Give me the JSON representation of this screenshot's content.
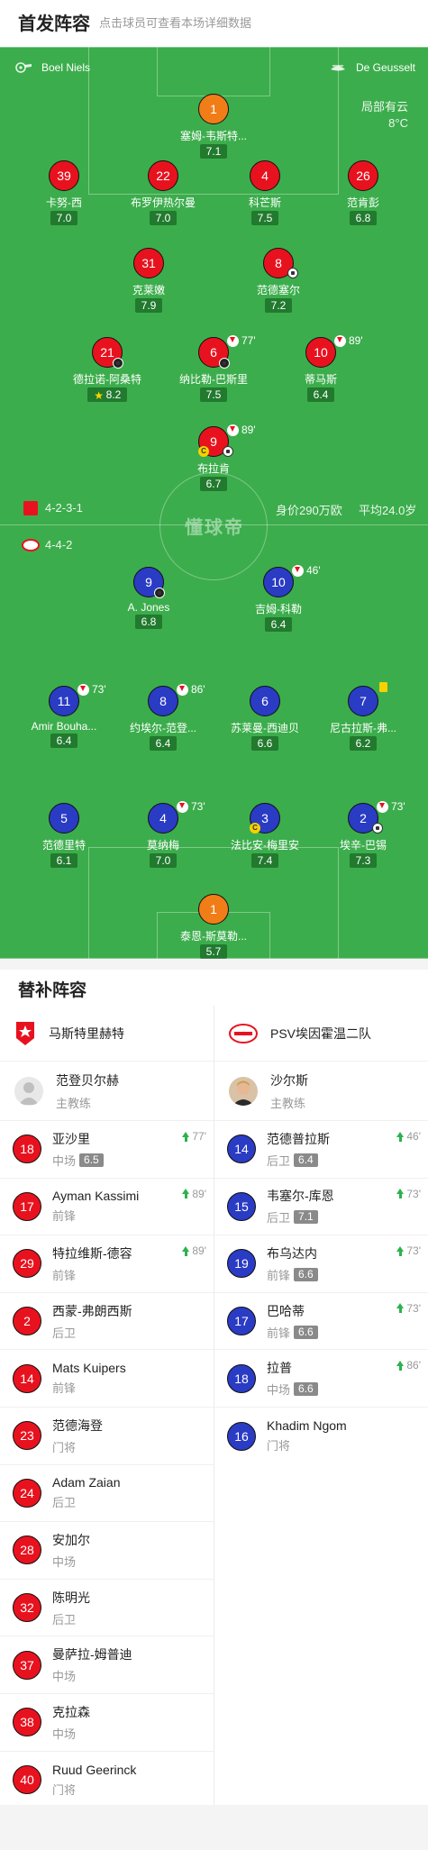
{
  "header": {
    "title": "首发阵容",
    "hint": "点击球员可查看本场详细数据"
  },
  "pitch": {
    "home_referee": "Boel Niels",
    "away_referee": "De Geusselt",
    "weather": {
      "condition": "局部有云",
      "temp": "8°C"
    },
    "home_formation": "4-2-3-1",
    "away_formation": "4-4-2",
    "market_value": "身价290万欧",
    "avg_age": "平均24.0岁",
    "watermark": "懂球帝",
    "home_players": [
      {
        "num": "1",
        "name": "塞姆-韦斯特...",
        "rating": "7.1"
      },
      {
        "num": "39",
        "name": "卡努-西",
        "rating": "7.0"
      },
      {
        "num": "22",
        "name": "布罗伊热尔曼",
        "rating": "7.0"
      },
      {
        "num": "4",
        "name": "科芒斯",
        "rating": "7.5"
      },
      {
        "num": "26",
        "name": "范肯彭",
        "rating": "6.8"
      },
      {
        "num": "31",
        "name": "克莱嫩",
        "rating": "7.9"
      },
      {
        "num": "8",
        "name": "范德塞尔",
        "rating": "7.2"
      },
      {
        "num": "21",
        "name": "德拉诺-阿桑特",
        "rating": "8.2"
      },
      {
        "num": "6",
        "name": "纳比勒-巴斯里",
        "rating": "7.5",
        "sub": "77'"
      },
      {
        "num": "10",
        "name": "蒂马斯",
        "rating": "6.4",
        "sub": "89'"
      },
      {
        "num": "9",
        "name": "布拉肯",
        "rating": "6.7",
        "sub": "89'"
      }
    ],
    "away_players": [
      {
        "num": "9",
        "name": "A. Jones",
        "rating": "6.8"
      },
      {
        "num": "10",
        "name": "吉姆-科勒",
        "rating": "6.4",
        "sub": "46'"
      },
      {
        "num": "11",
        "name": "Amir Bouha...",
        "rating": "6.4",
        "sub": "73'"
      },
      {
        "num": "8",
        "name": "约埃尔-范登...",
        "rating": "6.4",
        "sub": "86'"
      },
      {
        "num": "6",
        "name": "苏莱曼-西迪贝",
        "rating": "6.6"
      },
      {
        "num": "7",
        "name": "尼古拉斯-弗...",
        "rating": "6.2"
      },
      {
        "num": "5",
        "name": "范德里特",
        "rating": "6.1"
      },
      {
        "num": "4",
        "name": "莫纳梅",
        "rating": "7.0",
        "sub": "73'"
      },
      {
        "num": "3",
        "name": "法比安-梅里安",
        "rating": "7.4"
      },
      {
        "num": "2",
        "name": "埃辛-巴锡",
        "rating": "7.3",
        "sub": "73'"
      },
      {
        "num": "1",
        "name": "泰恩-斯莫勒...",
        "rating": "5.7"
      }
    ]
  },
  "subs": {
    "title": "替补阵容",
    "home": {
      "club": "马斯特里赫特",
      "coach": {
        "name": "范登贝尔赫",
        "role": "主教练"
      },
      "players": [
        {
          "num": "18",
          "name": "亚沙里",
          "pos": "中场",
          "rating": "6.5",
          "minute": "77'"
        },
        {
          "num": "17",
          "name": "Ayman Kassimi",
          "pos": "前锋",
          "minute": "89'"
        },
        {
          "num": "29",
          "name": "特拉维斯-德容",
          "pos": "前锋",
          "minute": "89'"
        },
        {
          "num": "2",
          "name": "西蒙-弗朗西斯",
          "pos": "后卫"
        },
        {
          "num": "14",
          "name": "Mats Kuipers",
          "pos": "前锋"
        },
        {
          "num": "23",
          "name": "范德海登",
          "pos": "门将"
        },
        {
          "num": "24",
          "name": "Adam Zaian",
          "pos": "后卫"
        },
        {
          "num": "28",
          "name": "安加尔",
          "pos": "中场"
        },
        {
          "num": "32",
          "name": "陈明光",
          "pos": "后卫"
        },
        {
          "num": "37",
          "name": "曼萨拉-姆普迪",
          "pos": "中场"
        },
        {
          "num": "38",
          "name": "克拉森",
          "pos": "中场"
        },
        {
          "num": "40",
          "name": "Ruud Geerinck",
          "pos": "门将"
        }
      ]
    },
    "away": {
      "club": "PSV埃因霍温二队",
      "coach": {
        "name": "沙尔斯",
        "role": "主教练"
      },
      "players": [
        {
          "num": "14",
          "name": "范德普拉斯",
          "pos": "后卫",
          "rating": "6.4",
          "minute": "46'"
        },
        {
          "num": "15",
          "name": "韦塞尔-库恩",
          "pos": "后卫",
          "rating": "7.1",
          "minute": "73'"
        },
        {
          "num": "19",
          "name": "布乌达内",
          "pos": "前锋",
          "rating": "6.6",
          "minute": "73'"
        },
        {
          "num": "17",
          "name": "巴哈蒂",
          "pos": "前锋",
          "rating": "6.6",
          "minute": "73'"
        },
        {
          "num": "18",
          "name": "拉普",
          "pos": "中场",
          "rating": "6.6",
          "minute": "86'"
        },
        {
          "num": "16",
          "name": "Khadim Ngom",
          "pos": "门将"
        }
      ]
    }
  },
  "colors": {
    "pitch": "#3cad4c",
    "home": "#e8121f",
    "away": "#2a3bc4",
    "keeper": "#f07d17"
  }
}
